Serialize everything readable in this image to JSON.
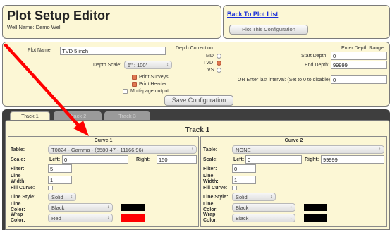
{
  "header": {
    "title": "Plot Setup Editor",
    "well_name": "Well Name: Demo Well",
    "back_link": "Back To Plot List",
    "plot_button": "Plot This Configuration"
  },
  "settings": {
    "plot_name_label": "Plot Name:",
    "plot_name_value": "TVD 5 inch",
    "depth_scale_label": "Depth Scale:",
    "depth_scale_value": "5\" : 100'",
    "depth_correction_label": "Depth Correction:",
    "md_label": "MD",
    "tvd_label": "TVD",
    "vs_label": "VS",
    "depth_correction_selected": "TVD",
    "print_surveys_label": "Print Surveys",
    "print_header_label": "Print Header",
    "multipage_label": "Multi-page output",
    "enter_depth_range_label": "Enter Depth Range:",
    "start_depth_label": "Start Depth:",
    "start_depth_value": "0",
    "end_depth_label": "End Depth:",
    "end_depth_value": "99999",
    "last_interval_label": "OR Enter last interval: (Set to 0 to disable)",
    "last_interval_value": "0",
    "save_button": "Save Configuration"
  },
  "tabs": [
    "Track 1",
    "Track 2",
    "Track 3"
  ],
  "track": {
    "title": "Track 1",
    "curve1": {
      "title": "Curve 1",
      "table_label": "Table:",
      "table_value": "T0824 - Gamma - (6580.47 - 11166.96)",
      "scale_label": "Scale:",
      "left_label": "Left:",
      "left_value": "0",
      "right_label": "Right:",
      "right_value": "150",
      "filter_label": "Filter:",
      "filter_value": "5",
      "line_width_label": "Line Width:",
      "line_width_value": "1",
      "fill_curve_label": "Fill Curve:",
      "line_style_label": "Line Style:",
      "line_style_value": "Solid",
      "line_color_label": "Line Color:",
      "line_color_value": "Black",
      "line_color_hex": "#000000",
      "wrap_color_label": "Wrap Color:",
      "wrap_color_value": "Red",
      "wrap_color_hex": "#ff0000"
    },
    "curve2": {
      "title": "Curve 2",
      "table_label": "Table:",
      "table_value": "NONE",
      "scale_label": "Scale:",
      "left_label": "Left:",
      "left_value": "0",
      "right_label": "Right:",
      "right_value": "99999",
      "filter_label": "Filter:",
      "filter_value": "0",
      "line_width_label": "Line Width:",
      "line_width_value": "1",
      "fill_curve_label": "Fill Curve:",
      "line_style_label": "Line Style:",
      "line_style_value": "Solid",
      "line_color_label": "Line Color:",
      "line_color_value": "Black",
      "line_color_hex": "#000000",
      "wrap_color_label": "Wrap Color:",
      "wrap_color_value": "Black",
      "wrap_color_hex": "#000000"
    }
  },
  "colors": {
    "panel_bg": "#fcf7d5",
    "link": "#1a2fd8",
    "accent_checked": "#e07850",
    "inactive_tab": "#9a9a9a",
    "annotation_arrow": "#ff0000"
  }
}
